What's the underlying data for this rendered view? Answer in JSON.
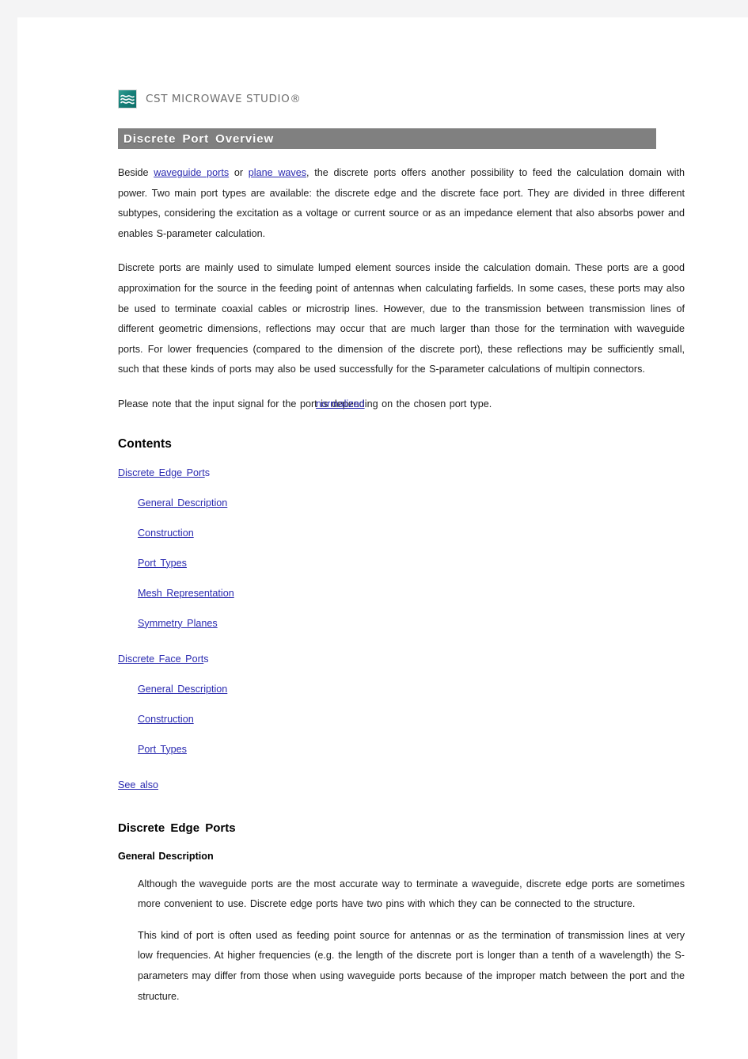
{
  "header": {
    "logo_icon": "cst-wave-logo-icon",
    "brand_text": "CST MICROWAVE STUDIO®",
    "brand_color": "#168079"
  },
  "title_bar": {
    "text": "Discrete Port Overview",
    "background": "#808080",
    "text_color": "#ffffff"
  },
  "intro": {
    "p1_a": "Beside ",
    "p1_link1": "waveguide ports",
    "p1_b": " or ",
    "p1_link2": "plane waves",
    "p1_c": ", the discrete ports offers another possibility to feed the calculation domain with power. Two main port types are available: the discrete edge and the discrete face port. They are divided in three different subtypes, considering the excitation as a voltage or current source or as an impedance element that also absorbs power and enables S-parameter calculation.",
    "p2": "Discrete ports are mainly used to simulate lumped element sources inside the calculation domain. These ports are a good approximation for the source in the feeding point of antennas when calculating farfields. In some cases, these ports may also be used to terminate coaxial cables or microstrip lines. However, due to the transmission between transmission lines of different geometric dimensions, reflections may occur that are much larger than those for the termination with waveguide ports. For lower frequencies (compared to the dimension of the discrete port), these reflections may be sufficiently small, such that these kinds of ports may also be used successfully for the S-parameter calculations of multipin connectors.",
    "p3_a": "Please note that the input signal for the ",
    "p3_overlap_plain": "port is",
    "p3_overlap_link": "normalized",
    "p3_b": " depending on the chosen port type."
  },
  "contents": {
    "heading": "Contents",
    "entries": [
      {
        "label": "Discrete Edge Port",
        "tail": "s",
        "level": 1
      },
      {
        "label": "General Description",
        "tail": "",
        "level": 2
      },
      {
        "label": "Construction",
        "tail": "",
        "level": 2
      },
      {
        "label": "Port Types",
        "tail": "",
        "level": 2
      },
      {
        "label": "Mesh Representation",
        "tail": "",
        "level": 2
      },
      {
        "label": "Symmetry Planes",
        "tail": "",
        "level": 2
      },
      {
        "label": "Discrete Face Port",
        "tail": "s",
        "level": 1
      },
      {
        "label": "General Description",
        "tail": "",
        "level": 2
      },
      {
        "label": "Construction",
        "tail": "",
        "level": 2
      },
      {
        "label": "Port Types",
        "tail": "",
        "level": 2
      },
      {
        "label": "See also",
        "tail": "",
        "level": 1
      }
    ],
    "link_color": "#2a2ab0"
  },
  "section_edge_ports": {
    "heading": "Discrete Edge Ports",
    "subheading": "General Description",
    "p1": "Although the waveguide ports are the most accurate way to terminate a waveguide, discrete edge ports are sometimes more convenient to use. Discrete edge ports have two pins with which they can be connected to the structure.",
    "p2": "This kind of port is often used as feeding point source for antennas or as the termination of transmission lines at very low frequencies. At higher frequencies (e.g. the length of the discrete port is longer than a tenth of a wavelength) the S-parameters may differ from those when using waveguide ports because of the improper match between the port and the structure."
  }
}
